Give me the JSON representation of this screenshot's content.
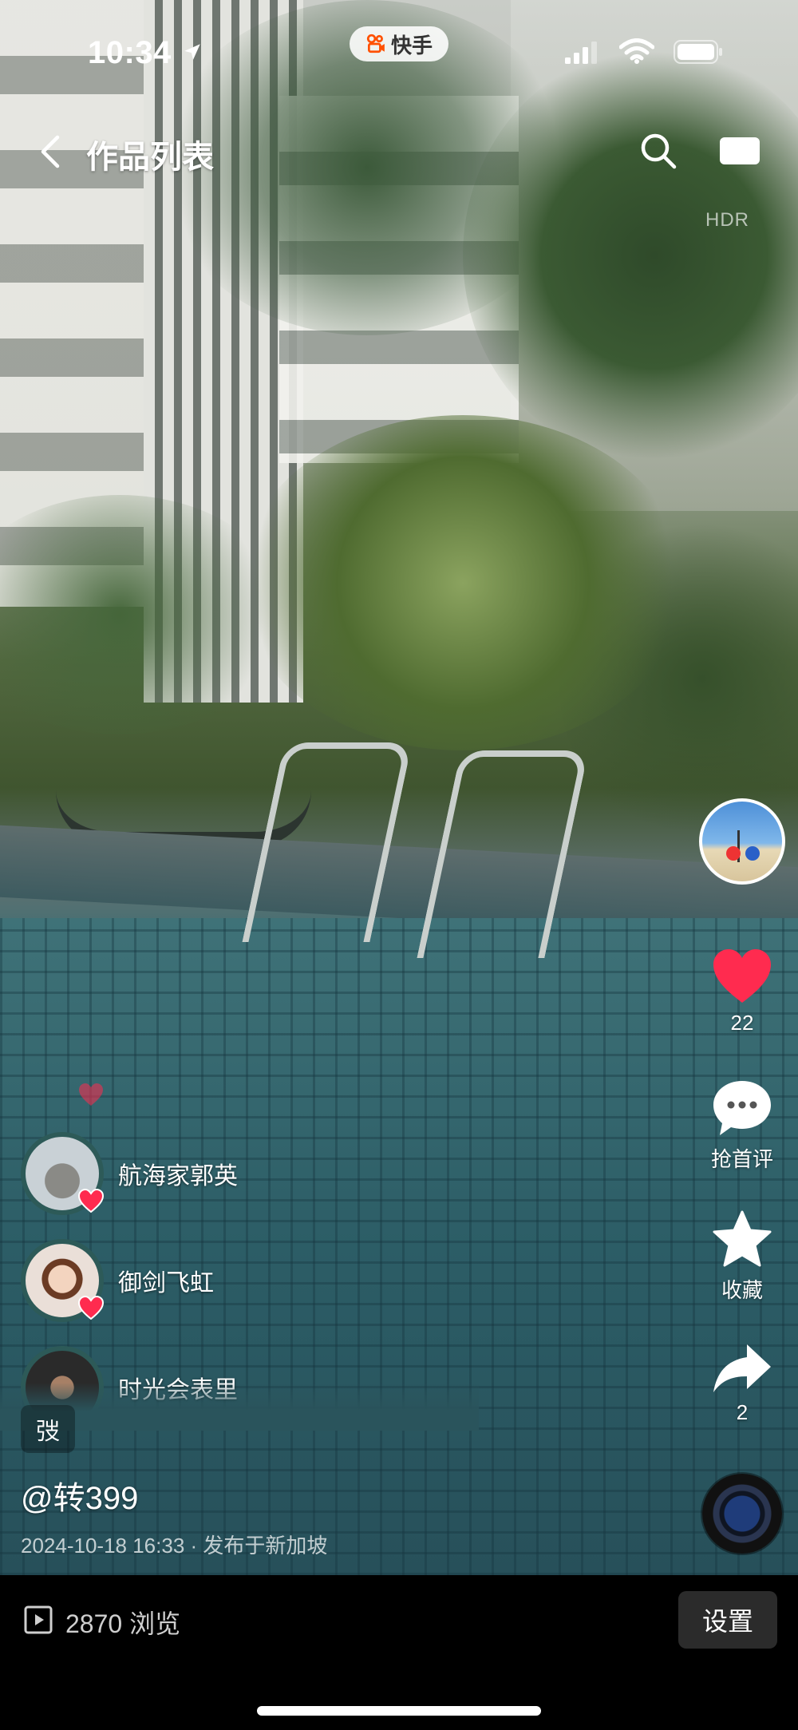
{
  "status_bar": {
    "time": "10:34",
    "app_badge": "快手"
  },
  "header": {
    "title": "作品列表",
    "hdr_label": "HDR"
  },
  "actions": {
    "like_count": "22",
    "comment_label": "抢首评",
    "favorite_label": "收藏",
    "share_count": "2"
  },
  "likers": [
    {
      "name": "航海家郭英"
    },
    {
      "name": "御剑飞虹"
    },
    {
      "name": "时光会表里"
    }
  ],
  "caption": {
    "tag": "弢",
    "author": "@转399",
    "meta": "2024-10-18 16:33 · 发布于新加坡"
  },
  "bottom_bar": {
    "views": "2870 浏览",
    "settings_label": "设置"
  },
  "colors": {
    "like_red": "#ff2b4f",
    "pool_teal": "#2c5d66"
  },
  "icons": [
    "location-arrow-icon",
    "kuaishou-logo-icon",
    "signal-icon",
    "wifi-icon",
    "battery-icon",
    "back-icon",
    "search-icon",
    "screen-icon",
    "heart-icon",
    "comment-icon",
    "star-icon",
    "share-icon",
    "play-icon",
    "music-disc-icon"
  ]
}
